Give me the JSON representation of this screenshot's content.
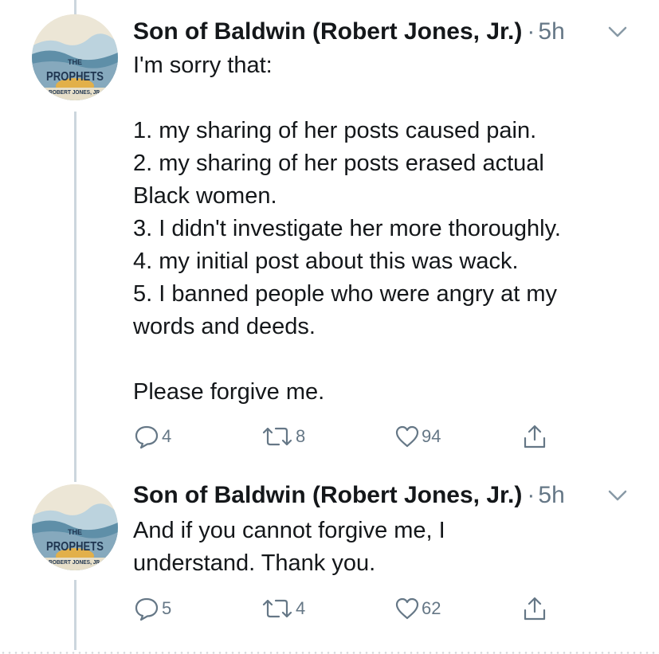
{
  "tweets": [
    {
      "author": "Son of Baldwin (Robert Jones, Jr.)",
      "separator": "·",
      "time": "5h",
      "avatar": {
        "line1": "THE",
        "line2": "PROPHETS",
        "line3": "ROBERT JONES, JR."
      },
      "text_lines": [
        "I'm sorry that:",
        "",
        "1. my sharing of her posts caused pain.",
        "2. my sharing of her posts erased actual",
        "Black women.",
        "3. I didn't investigate her more thoroughly.",
        "4. my initial post about this was wack.",
        "5. I banned people who were angry at my",
        "words and deeds.",
        "",
        "Please forgive me."
      ],
      "actions": {
        "replies": "4",
        "retweets": "8",
        "likes": "94"
      }
    },
    {
      "author": "Son of Baldwin (Robert Jones, Jr.)",
      "separator": "·",
      "time": "5h",
      "avatar": {
        "line1": "THE",
        "line2": "PROPHETS",
        "line3": "ROBERT JONES, JR."
      },
      "text_lines": [
        "And if you cannot forgive me, I",
        "understand. Thank you."
      ],
      "actions": {
        "replies": "5",
        "retweets": "4",
        "likes": "62"
      }
    }
  ],
  "icons": {
    "reply": "reply-icon",
    "retweet": "retweet-icon",
    "like": "heart-icon",
    "share": "share-icon",
    "menu": "chevron-down-icon"
  },
  "colors": {
    "text": "#14171a",
    "muted": "#657786",
    "thread_line": "#ccd6dd",
    "avatar_blue": "#5f8fa8",
    "avatar_navy": "#1f3550",
    "avatar_sun": "#e2b04a"
  }
}
